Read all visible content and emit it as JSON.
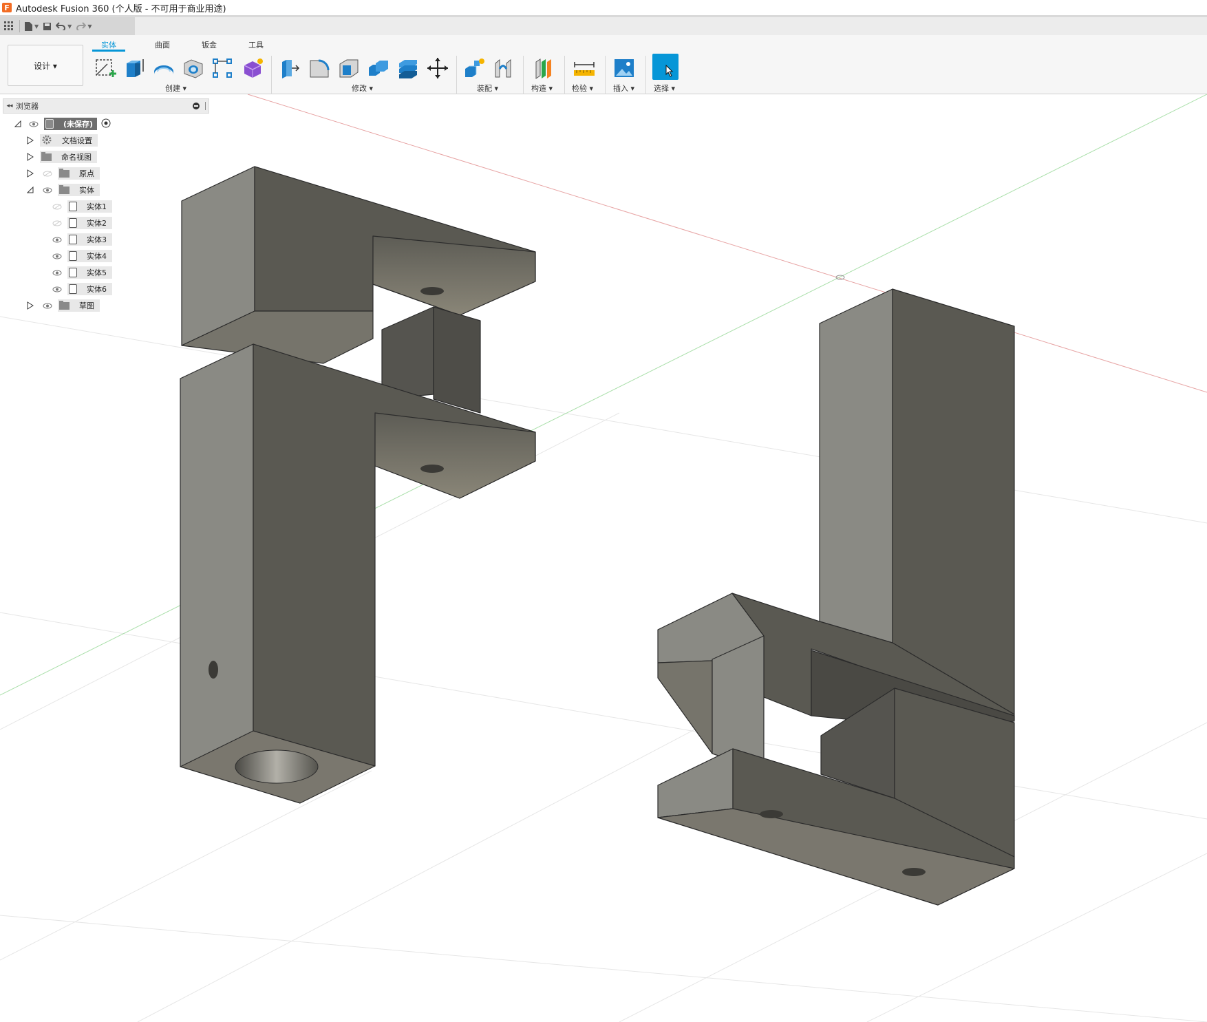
{
  "titlebar": {
    "logo": "F",
    "title": "Autodesk Fusion 360 (个人版 - 不可用于商业用途)"
  },
  "quick_access": {
    "icons": [
      "grid-icon",
      "file-icon",
      "save-icon",
      "undo-icon",
      "redo-icon"
    ]
  },
  "ribbon": {
    "workspace": "设计 ▾",
    "tabs": [
      "实体",
      "曲面",
      "钣金",
      "工具"
    ],
    "active_tab": "实体",
    "groups": {
      "create": "创建 ▾",
      "modify": "修改 ▾",
      "assemble": "装配 ▾",
      "construct": "构造 ▾",
      "inspect": "检验 ▾",
      "insert": "插入 ▾",
      "select": "选择 ▾"
    },
    "accent_color": "#0696d7"
  },
  "browser": {
    "title": "浏览器",
    "collapse": "◂◂",
    "root": "(未保存)",
    "items": [
      {
        "label": "文档设置",
        "icon": "gear-icon"
      },
      {
        "label": "命名视图",
        "icon": "folder-icon"
      },
      {
        "label": "原点",
        "icon": "folder-icon"
      },
      {
        "label": "实体",
        "icon": "folder-icon"
      },
      {
        "label": "草图",
        "icon": "folder-icon"
      }
    ],
    "bodies": [
      "实体1",
      "实体2",
      "实体3",
      "实体4",
      "实体5",
      "实体6"
    ]
  }
}
